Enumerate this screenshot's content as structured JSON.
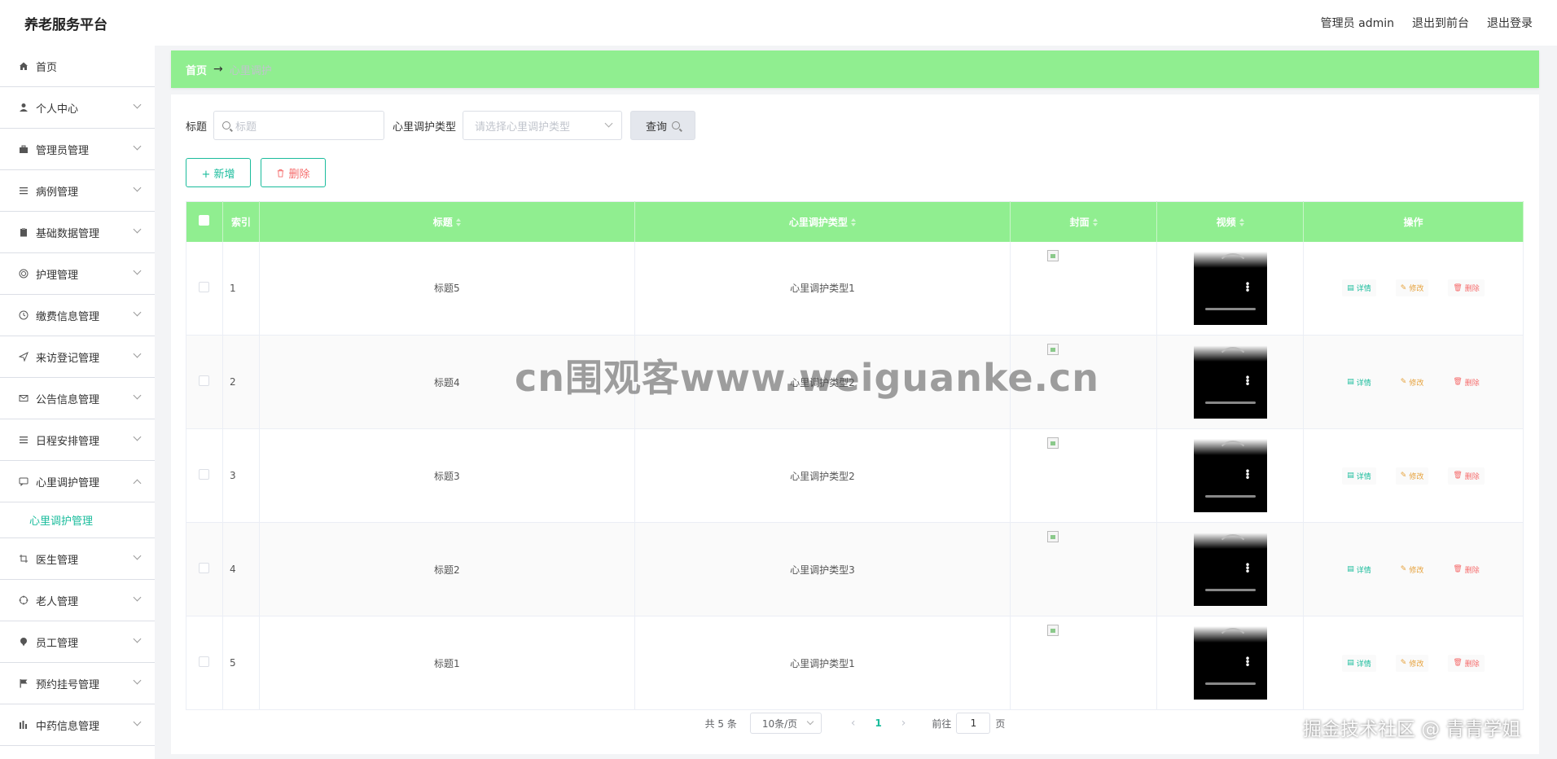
{
  "app": {
    "title": "养老服务平台"
  },
  "header": {
    "user_label": "管理员 admin",
    "to_front": "退出到前台",
    "logout": "退出登录"
  },
  "sidebar": {
    "items": [
      {
        "label": "首页",
        "icon": "home-icon",
        "expandable": false
      },
      {
        "label": "个人中心",
        "icon": "user-icon",
        "expandable": true
      },
      {
        "label": "管理员管理",
        "icon": "briefcase-icon",
        "expandable": true
      },
      {
        "label": "病例管理",
        "icon": "list-icon",
        "expandable": true
      },
      {
        "label": "基础数据管理",
        "icon": "clipboard-icon",
        "expandable": true
      },
      {
        "label": "护理管理",
        "icon": "target-icon",
        "expandable": true
      },
      {
        "label": "缴费信息管理",
        "icon": "clock-icon",
        "expandable": true
      },
      {
        "label": "来访登记管理",
        "icon": "send-icon",
        "expandable": true
      },
      {
        "label": "公告信息管理",
        "icon": "mail-icon",
        "expandable": true
      },
      {
        "label": "日程安排管理",
        "icon": "list-icon",
        "expandable": true
      },
      {
        "label": "心里调护管理",
        "icon": "chat-icon",
        "expandable": true,
        "expanded": true,
        "sub": "心里调护管理"
      },
      {
        "label": "医生管理",
        "icon": "crop-icon",
        "expandable": true
      },
      {
        "label": "老人管理",
        "icon": "aim-icon",
        "expandable": true
      },
      {
        "label": "员工管理",
        "icon": "pin-icon",
        "expandable": true
      },
      {
        "label": "预约挂号管理",
        "icon": "flag-icon",
        "expandable": true
      },
      {
        "label": "中药信息管理",
        "icon": "chart-icon",
        "expandable": true
      }
    ]
  },
  "breadcrumb": {
    "home": "首页",
    "arrow": "→",
    "current": "心里调护"
  },
  "search": {
    "title_label": "标题",
    "title_placeholder": "标题",
    "type_label": "心里调护类型",
    "type_placeholder": "请选择心里调护类型",
    "query_button": "查询"
  },
  "actions": {
    "add": "+ 新增",
    "delete": "删除"
  },
  "table": {
    "columns": [
      "索引",
      "标题",
      "心里调护类型",
      "封面",
      "视频",
      "操作"
    ],
    "rows": [
      {
        "index": "1",
        "title": "标题5",
        "type": "心里调护类型1"
      },
      {
        "index": "2",
        "title": "标题4",
        "type": "心里调护类型2"
      },
      {
        "index": "3",
        "title": "标题3",
        "type": "心里调护类型2"
      },
      {
        "index": "4",
        "title": "标题2",
        "type": "心里调护类型3"
      },
      {
        "index": "5",
        "title": "标题1",
        "type": "心里调护类型1"
      }
    ],
    "op_detail": "详情",
    "op_edit": "修改",
    "op_delete": "删除"
  },
  "pagination": {
    "total": "共 5 条",
    "page_size": "10条/页",
    "current_page": "1",
    "goto_label": "前往",
    "goto_value": "1",
    "page_unit": "页"
  },
  "watermarks": {
    "center": "cn围观客www.weiguanke.cn",
    "corner": "掘金技术社区 @ 青青学姐"
  },
  "colors": {
    "accent": "#90ee90",
    "primary": "#1abc9c",
    "danger": "#f56c6c",
    "warning": "#e6a23c"
  }
}
